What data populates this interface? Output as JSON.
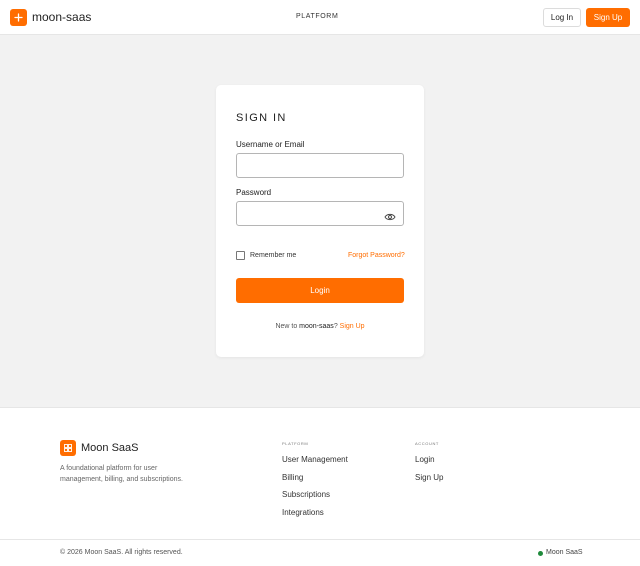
{
  "header": {
    "brand": "moon-saas",
    "nav_platform": "PLATFORM",
    "login_label": "Log In",
    "signup_label": "Sign Up"
  },
  "signin": {
    "title": "SIGN IN",
    "username_label": "Username or Email",
    "username_value": "",
    "password_label": "Password",
    "password_value": "",
    "remember_label": "Remember me",
    "remember_checked": false,
    "forgot_label": "Forgot Password?",
    "submit_label": "Login",
    "new_prefix": "New to ",
    "new_brand": "moon-saas",
    "new_suffix": "? ",
    "signup_link": "Sign Up"
  },
  "footer": {
    "brand": "Moon SaaS",
    "description": "A foundational platform for user management, billing, and subscriptions.",
    "platform_heading": "PLATFORM",
    "platform_links": [
      "User Management",
      "Billing",
      "Subscriptions",
      "Integrations"
    ],
    "account_heading": "ACCOUNT",
    "account_links": [
      "Login",
      "Sign Up"
    ],
    "copyright": "© 2026 Moon SaaS. All rights reserved.",
    "status_text": "Moon SaaS"
  },
  "icons": {
    "header_logo": "plus-icon",
    "footer_logo": "grid-icon",
    "password_toggle": "eye-icon"
  },
  "colors": {
    "accent": "#ff6d00",
    "status": "#1f8a3b"
  }
}
